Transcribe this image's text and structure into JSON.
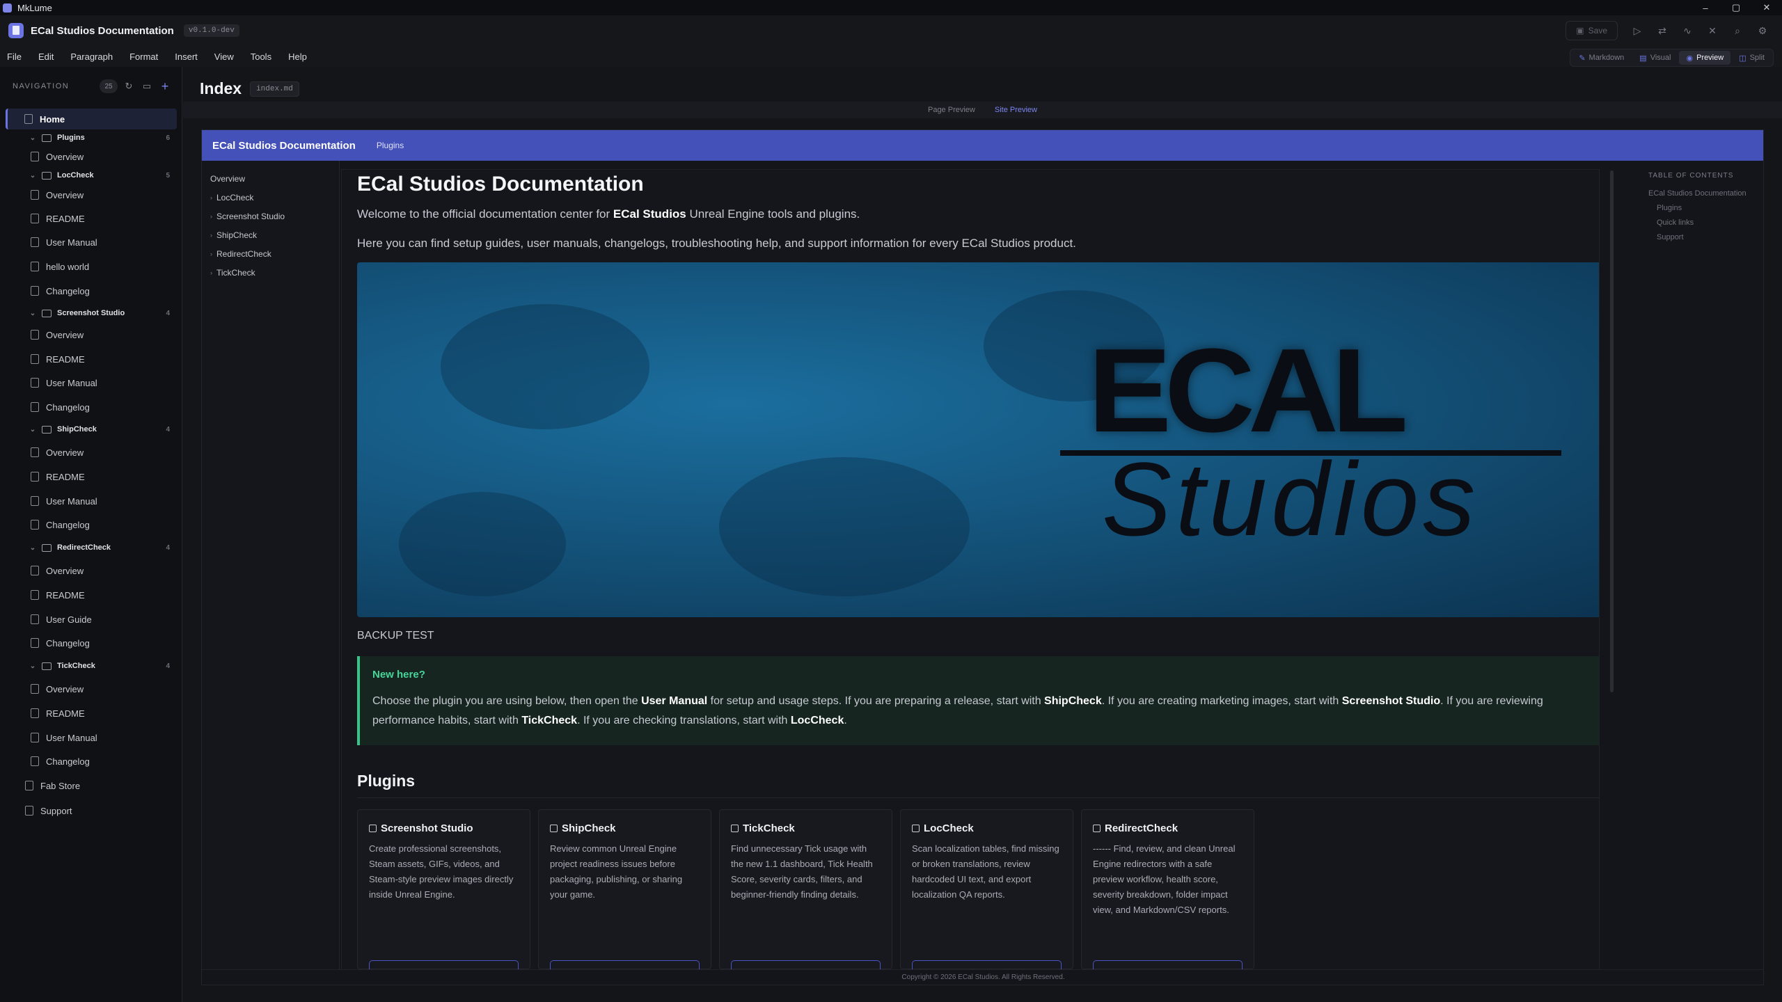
{
  "window": {
    "app_name": "MkLume",
    "controls": [
      "–",
      "▢",
      "✕"
    ]
  },
  "header": {
    "doc_title": "ECal Studios Documentation",
    "version": "v0.1.0-dev",
    "save_label": "Save"
  },
  "menu": [
    "File",
    "Edit",
    "Paragraph",
    "Format",
    "Insert",
    "View",
    "Tools",
    "Help"
  ],
  "view_modes": [
    {
      "label": "Markdown",
      "active": false
    },
    {
      "label": "Visual",
      "active": false
    },
    {
      "label": "Preview",
      "active": true
    },
    {
      "label": "Split",
      "active": false
    }
  ],
  "sidebar": {
    "title": "NAVIGATION",
    "count": "25",
    "items": [
      {
        "label": "Home",
        "type": "home"
      },
      {
        "label": "Plugins",
        "type": "folder",
        "num": "6"
      },
      {
        "label": "Overview",
        "type": "page"
      },
      {
        "label": "LocCheck",
        "type": "folder",
        "num": "5"
      },
      {
        "label": "Overview",
        "type": "page"
      },
      {
        "label": "README",
        "type": "page"
      },
      {
        "label": "User Manual",
        "type": "page"
      },
      {
        "label": "hello world",
        "type": "page"
      },
      {
        "label": "Changelog",
        "type": "page"
      },
      {
        "label": "Screenshot Studio",
        "type": "folder",
        "num": "4"
      },
      {
        "label": "Overview",
        "type": "page"
      },
      {
        "label": "README",
        "type": "page"
      },
      {
        "label": "User Manual",
        "type": "page"
      },
      {
        "label": "Changelog",
        "type": "page"
      },
      {
        "label": "ShipCheck",
        "type": "folder",
        "num": "4"
      },
      {
        "label": "Overview",
        "type": "page"
      },
      {
        "label": "README",
        "type": "page"
      },
      {
        "label": "User Manual",
        "type": "page"
      },
      {
        "label": "Changelog",
        "type": "page"
      },
      {
        "label": "RedirectCheck",
        "type": "folder",
        "num": "4"
      },
      {
        "label": "Overview",
        "type": "page"
      },
      {
        "label": "README",
        "type": "page"
      },
      {
        "label": "User Guide",
        "type": "page"
      },
      {
        "label": "Changelog",
        "type": "page"
      },
      {
        "label": "TickCheck",
        "type": "folder",
        "num": "4"
      },
      {
        "label": "Overview",
        "type": "page"
      },
      {
        "label": "README",
        "type": "page"
      },
      {
        "label": "User Manual",
        "type": "page"
      },
      {
        "label": "Changelog",
        "type": "page"
      },
      {
        "label": "Fab Store",
        "type": "root"
      },
      {
        "label": "Support",
        "type": "root"
      }
    ]
  },
  "page": {
    "title": "Index",
    "file": "index.md"
  },
  "preview_tabs": [
    {
      "label": "Page Preview",
      "active": false
    },
    {
      "label": "Site Preview",
      "active": true
    }
  ],
  "site": {
    "brand": "ECal Studios Documentation",
    "top_link": "Plugins",
    "left_nav": [
      {
        "label": "Overview",
        "chevron": false
      },
      {
        "label": "LocCheck",
        "chevron": true
      },
      {
        "label": "Screenshot Studio",
        "chevron": true
      },
      {
        "label": "ShipCheck",
        "chevron": true
      },
      {
        "label": "RedirectCheck",
        "chevron": true
      },
      {
        "label": "TickCheck",
        "chevron": true
      }
    ],
    "h1": "ECal Studios Documentation",
    "intro1_pre": "Welcome to the official documentation center for ",
    "intro1_bold": "ECal Studios",
    "intro1_post": " Unreal Engine tools and plugins.",
    "intro2": "Here you can find setup guides, user manuals, changelogs, troubleshooting help, and support information for every ECal Studios product.",
    "hero_logo_top": "ECAL",
    "hero_logo_bottom": "Studios",
    "backup_text": "BACKUP TEST",
    "callout_title": "New here?",
    "callout_parts": [
      {
        "t": "Choose the plugin you are using below, then open the ",
        "b": false
      },
      {
        "t": "User Manual",
        "b": true
      },
      {
        "t": " for setup and usage steps. If you are preparing a release, start with ",
        "b": false
      },
      {
        "t": "ShipCheck",
        "b": true
      },
      {
        "t": ". If you are creating marketing images, start with ",
        "b": false
      },
      {
        "t": "Screenshot Studio",
        "b": true
      },
      {
        "t": ". If you are reviewing performance habits, start with ",
        "b": false
      },
      {
        "t": "TickCheck",
        "b": true
      },
      {
        "t": ". If you are checking translations, start with ",
        "b": false
      },
      {
        "t": "LocCheck",
        "b": true
      },
      {
        "t": ".",
        "b": false
      }
    ],
    "plugins_heading": "Plugins",
    "cards": [
      {
        "title": "Screenshot Studio",
        "desc": "Create professional screenshots, Steam assets, GIFs, videos, and Steam-style preview images directly inside Unreal Engine."
      },
      {
        "title": "ShipCheck",
        "desc": "Review common Unreal Engine project readiness issues before packaging, publishing, or sharing your game."
      },
      {
        "title": "TickCheck",
        "desc": "Find unnecessary Tick usage with the new 1.1 dashboard, Tick Health Score, severity cards, filters, and beginner-friendly finding details."
      },
      {
        "title": "LocCheck",
        "desc": "Scan localization tables, find missing or broken translations, review hardcoded UI text, and export localization QA reports."
      },
      {
        "title": "RedirectCheck",
        "desc": "------ Find, review, and clean Unreal Engine redirectors with a safe preview workflow, health score, severity breakdown, folder impact view, and Markdown/CSV reports."
      }
    ],
    "toc_title": "TABLE OF CONTENTS",
    "toc": [
      {
        "label": "ECal Studios Documentation",
        "sub": false
      },
      {
        "label": "Plugins",
        "sub": true
      },
      {
        "label": "Quick links",
        "sub": true
      },
      {
        "label": "Support",
        "sub": true
      }
    ],
    "footer": "Copyright © 2026 ECal Studios. All Rights Reserved."
  }
}
